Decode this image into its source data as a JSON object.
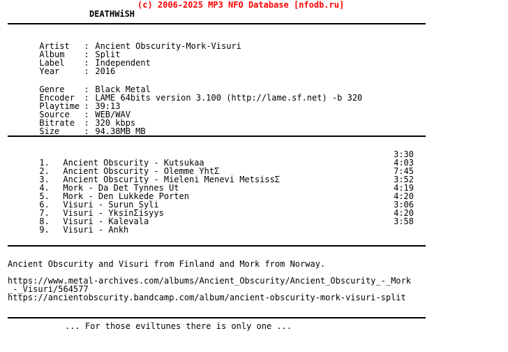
{
  "header": {
    "copyright": "(c) 2006-2025 MP3 NFO Database [nfodb.ru]",
    "copyright_color": "#ff0000",
    "group": "DEATHWiSH"
  },
  "release_info": {
    "rows": [
      {
        "label": "Artist",
        "sep": ":",
        "value": "Ancient Obscurity-Mork-Visuri"
      },
      {
        "label": "Album",
        "sep": ":",
        "value": "Split"
      },
      {
        "label": "Label",
        "sep": ":",
        "value": "Independent"
      },
      {
        "label": "Year",
        "sep": ":",
        "value": "2016"
      }
    ]
  },
  "technical_info": {
    "rows": [
      {
        "label": "Genre",
        "sep": ":",
        "value": "Black Metal"
      },
      {
        "label": "Encoder",
        "sep": ":",
        "value": "LAME 64bits version 3.100 (http://lame.sf.net) -b 320"
      },
      {
        "label": "Playtime",
        "sep": ":",
        "value": "39:13"
      },
      {
        "label": "Source",
        "sep": ":",
        "value": "WEB/WAV"
      },
      {
        "label": "Bitrate",
        "sep": ":",
        "value": "320 kbps"
      },
      {
        "label": "Size",
        "sep": ":",
        "value": "94.38MB MB"
      }
    ]
  },
  "tracklist": [
    {
      "num": "1.",
      "title": "Ancient Obscurity - Kutsukaa",
      "time": "3:30"
    },
    {
      "num": "2.",
      "title": "Ancient Obscurity - Olemme YhtΣ",
      "time": "4:03"
    },
    {
      "num": "3.",
      "title": "Ancient Obscurity - Mieleni Menevi MetsissΣ",
      "time": "7:45"
    },
    {
      "num": "4.",
      "title": "Mork - Da Det Tynnes Ut",
      "time": "3:52"
    },
    {
      "num": "5.",
      "title": "Mork - Den Lukkede Porten",
      "time": "4:19"
    },
    {
      "num": "6.",
      "title": "Visuri - Surun Syli",
      "time": "4:20"
    },
    {
      "num": "7.",
      "title": "Visuri - YksinΣisyys",
      "time": "3:06"
    },
    {
      "num": "8.",
      "title": "Visuri - Kalevala",
      "time": "4:20"
    },
    {
      "num": "9.",
      "title": "Visuri - Ankh",
      "time": "3:58"
    }
  ],
  "notes": {
    "description": "Ancient Obscurity and Visuri from Finland and Mork from Norway."
  },
  "links": {
    "line1": "https://www.metal-archives.com/albums/Ancient_Obscurity/Ancient_Obscurity_-_Mork",
    "line2": "_-_Visuri/564577",
    "line3": "https://ancientobscurity.bandcamp.com/album/ancient-obscurity-mork-visuri-split"
  },
  "footer": {
    "tagline": "... For those eviltunes there is only one ..."
  }
}
